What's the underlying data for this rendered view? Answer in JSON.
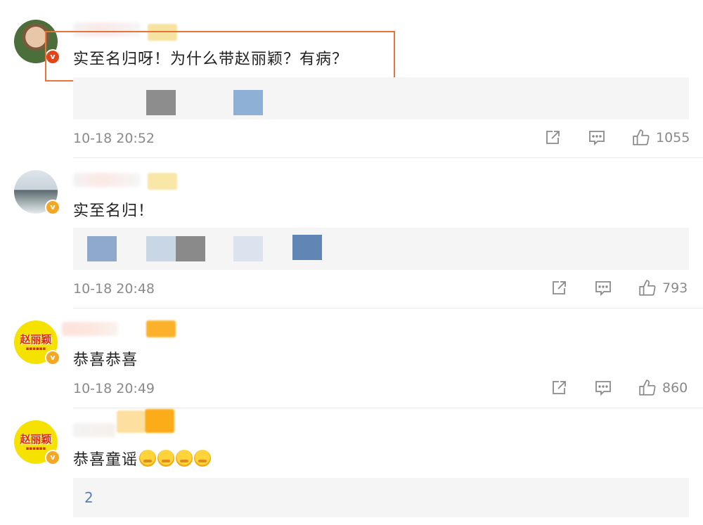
{
  "comments": [
    {
      "text": "实至名归呀！为什么带赵丽颖？有病？",
      "time": "10-18 20:52",
      "likes": "1055",
      "avatar": "photo-boy",
      "badge": "v",
      "highlighted": true
    },
    {
      "text": "实至名归！",
      "time": "10-18 20:48",
      "likes": "793",
      "avatar": "photo-lake",
      "badge": "v"
    },
    {
      "text": "恭喜恭喜",
      "time": "10-18 20:49",
      "likes": "860",
      "avatar": "poster",
      "badge": "v"
    },
    {
      "text": "恭喜童谣",
      "time": "",
      "likes": "",
      "avatar": "poster",
      "badge": "v",
      "reply_preview": "2"
    }
  ],
  "poster_avatar": {
    "title": "赵丽颖"
  },
  "icons": {
    "share": "share-icon",
    "comment": "comment-icon",
    "like": "thumbs-up-icon",
    "emoji": "smile-emoji-icon"
  },
  "colors": {
    "highlight": "#e8743b",
    "badge": "#f5a623",
    "badge_red": "#e0451b",
    "meta": "#8a8a8a",
    "reply_bg": "#f5f5f5"
  }
}
